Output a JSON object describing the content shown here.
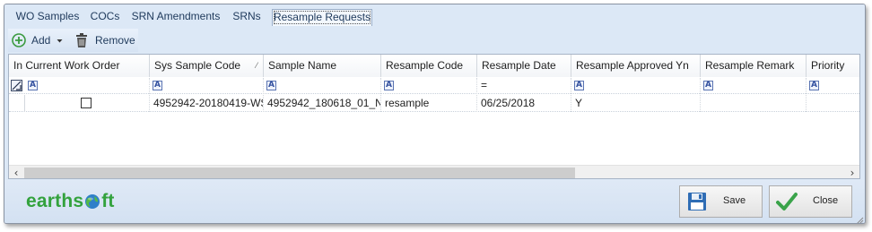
{
  "tabs": [
    {
      "label": "WO Samples"
    },
    {
      "label": "COCs"
    },
    {
      "label": "SRN Amendments"
    },
    {
      "label": "SRNs"
    },
    {
      "label": "Resample Requests",
      "active": true
    }
  ],
  "toolbar": {
    "add_label": "Add",
    "remove_label": "Remove"
  },
  "grid": {
    "columns": [
      "In Current Work Order",
      "Sys Sample Code",
      "Sample Name",
      "Resample Code",
      "Resample Date",
      "Resample Approved Yn",
      "Resample Remark",
      "Priority"
    ],
    "filters": {
      "resample_date_operator": "="
    },
    "rows": [
      {
        "in_current_work_order": false,
        "sys_sample_code": "4952942-20180419-WS",
        "sample_name": "4952942_180618_01_N",
        "resample_code": "resample",
        "resample_date": "06/25/2018",
        "resample_approved_yn": "Y",
        "resample_remark": "",
        "priority": ""
      }
    ]
  },
  "footer": {
    "logo_text_left": "earths",
    "logo_text_right": "ft",
    "save_label": "Save",
    "close_label": "Close"
  },
  "colors": {
    "window_bg": "#dce8f6",
    "logo_green": "#33a23d",
    "save_icon_blue": "#2f6db5",
    "close_check_green": "#3aa34a"
  },
  "icons": [
    "add-circle-icon",
    "dropdown-arrow-icon",
    "trash-icon",
    "sort-indicator-icon",
    "filter-text-icon",
    "filter-row-icon",
    "save-disk-icon",
    "checkmark-icon",
    "globe-icon",
    "resize-grip-icon"
  ]
}
